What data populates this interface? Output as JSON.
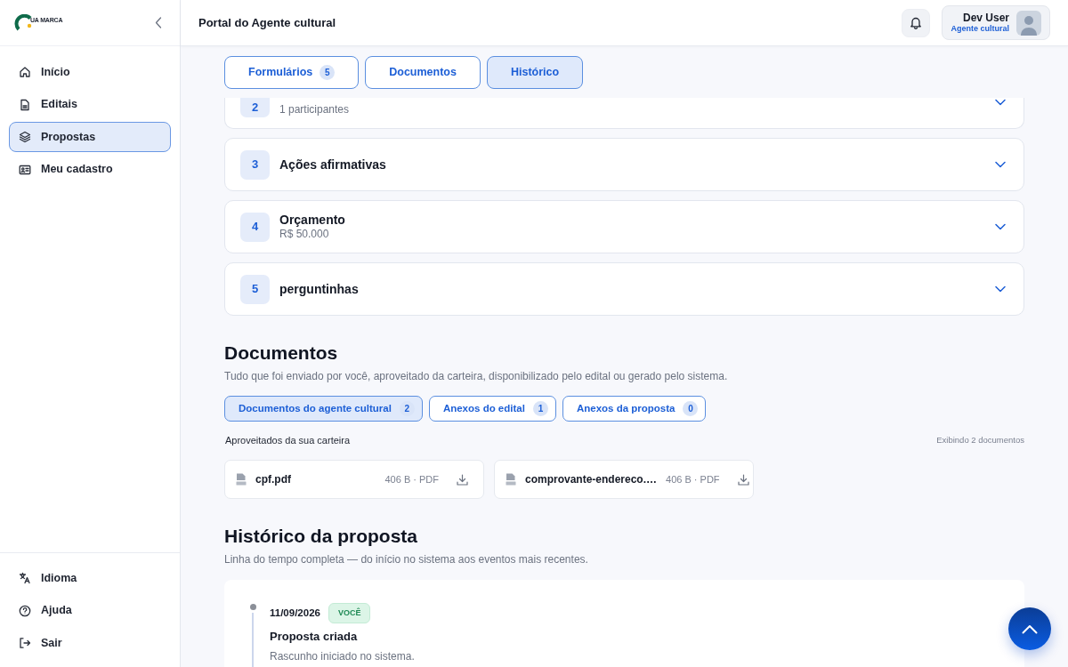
{
  "sidebar": {
    "logo_text": "UA MARCA",
    "nav": [
      {
        "label": "Início",
        "selected": false
      },
      {
        "label": "Editais",
        "selected": false
      },
      {
        "label": "Propostas",
        "selected": true
      },
      {
        "label": "Meu cadastro",
        "selected": false
      }
    ],
    "footer_nav": [
      {
        "label": "Idioma"
      },
      {
        "label": "Ajuda"
      },
      {
        "label": "Sair"
      }
    ]
  },
  "header": {
    "title": "Portal do Agente cultural",
    "user": {
      "name": "Dev User",
      "role": "Agente cultural"
    }
  },
  "section_tabs": [
    {
      "label": "Formulários",
      "count": "5",
      "selected": false
    },
    {
      "label": "Documentos",
      "selected": false
    },
    {
      "label": "Histórico",
      "selected": true
    }
  ],
  "form_sections": [
    {
      "number": "2",
      "subtitle": "1 participantes",
      "expanded": false
    },
    {
      "number": "3",
      "title": "Ações afirmativas",
      "expanded": false
    },
    {
      "number": "4",
      "title": "Orçamento",
      "subtitle": "R$ 50.000",
      "expanded": false
    },
    {
      "number": "5",
      "title": "perguntinhas",
      "expanded": false
    }
  ],
  "documents": {
    "title": "Documentos",
    "description": "Tudo que foi enviado por você, aproveitado da carteira, disponibilizado pelo edital ou gerado pelo sistema.",
    "tabs": [
      {
        "label": "Documentos do agente cultural",
        "count": "2",
        "selected": true
      },
      {
        "label": "Anexos do edital",
        "count": "1",
        "selected": false
      },
      {
        "label": "Anexos da proposta",
        "count": "0",
        "selected": false
      }
    ],
    "group_label": "Aproveitados da sua carteira",
    "count_label": "Exibindo 2 documentos",
    "files": [
      {
        "name": "cpf.pdf",
        "meta": "406 B · PDF"
      },
      {
        "name": "comprovante-endereco.…",
        "meta": "406 B · PDF"
      }
    ]
  },
  "history": {
    "title": "Histórico da proposta",
    "description": "Linha do tempo completa — do início no sistema aos eventos mais recentes.",
    "events": [
      {
        "date": "11/09/2026",
        "author": "VOCÊ",
        "title": "Proposta criada",
        "description": "Rascunho iniciado no sistema."
      }
    ]
  }
}
